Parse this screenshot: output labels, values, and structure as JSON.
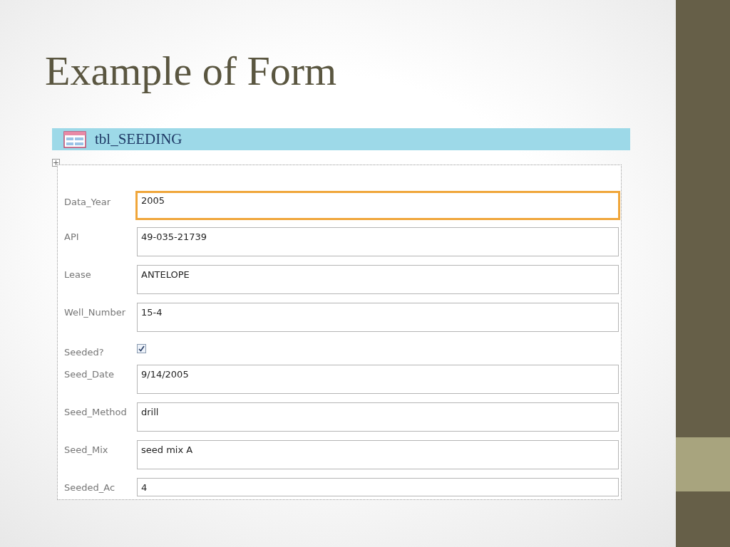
{
  "slide": {
    "title": "Example of Form"
  },
  "form": {
    "title": "tbl_SEEDING",
    "fields": [
      {
        "label": "Data_Year",
        "kind": "text",
        "value": "2005",
        "selected": true
      },
      {
        "label": "API",
        "kind": "text",
        "value": "49-035-21739",
        "selected": false
      },
      {
        "label": "Lease",
        "kind": "text",
        "value": "ANTELOPE",
        "selected": false
      },
      {
        "label": "Well_Number",
        "kind": "text",
        "value": "15-4",
        "selected": false
      },
      {
        "label": "Seeded?",
        "kind": "checkbox",
        "checked": true
      },
      {
        "label": "Seed_Date",
        "kind": "text",
        "value": "9/14/2005",
        "selected": false
      },
      {
        "label": "Seed_Method",
        "kind": "text",
        "value": "drill",
        "selected": false
      },
      {
        "label": "Seed_Mix",
        "kind": "text",
        "value": "seed mix A",
        "selected": false
      },
      {
        "label": "Seeded_Ac",
        "kind": "text",
        "value": "4",
        "selected": false
      }
    ]
  }
}
